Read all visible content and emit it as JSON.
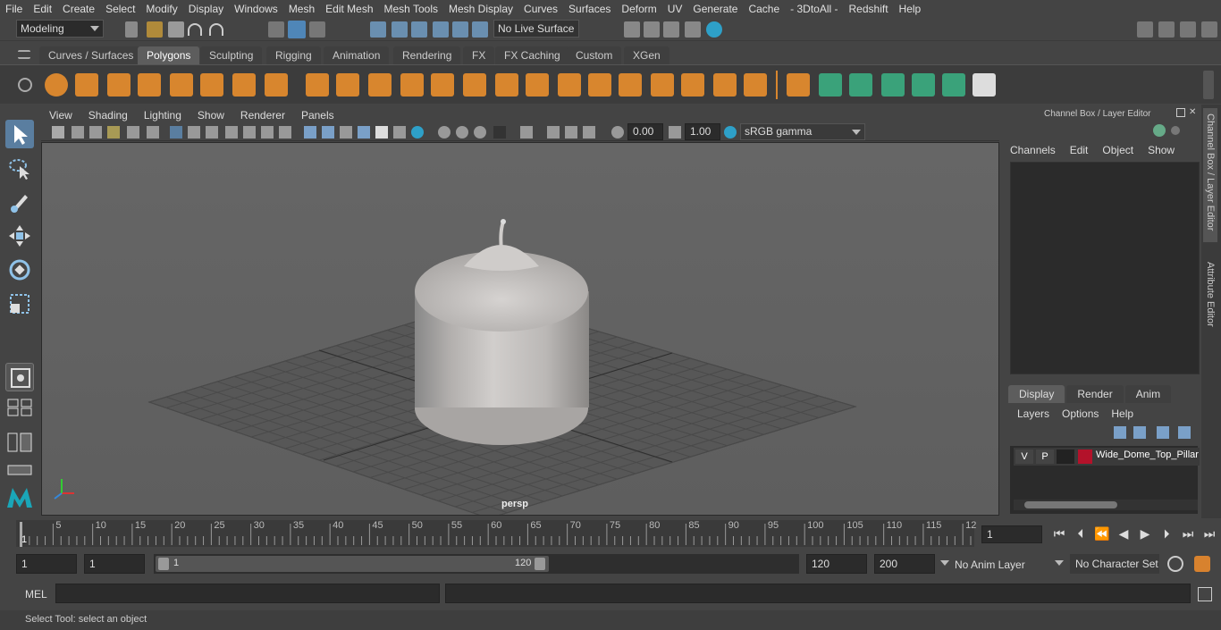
{
  "menu": [
    "File",
    "Edit",
    "Create",
    "Select",
    "Modify",
    "Display",
    "Windows",
    "Mesh",
    "Edit Mesh",
    "Mesh Tools",
    "Mesh Display",
    "Curves",
    "Surfaces",
    "Deform",
    "UV",
    "Generate",
    "Cache",
    "- 3DtoAll -",
    "Redshift",
    "Help"
  ],
  "status": {
    "mode": "Modeling",
    "live_surface": "No Live Surface"
  },
  "shelf_tabs": [
    "Curves / Surfaces",
    "Polygons",
    "Sculpting",
    "Rigging",
    "Animation",
    "Rendering",
    "FX",
    "FX Caching",
    "Custom",
    "XGen"
  ],
  "shelf_active": "Polygons",
  "viewport": {
    "menus": [
      "View",
      "Shading",
      "Lighting",
      "Show",
      "Renderer",
      "Panels"
    ],
    "exposure": "0.00",
    "gamma": "1.00",
    "color_space": "sRGB gamma",
    "camera_label": "persp"
  },
  "channel_box": {
    "title": "Channel Box / Layer Editor",
    "menus": [
      "Channels",
      "Edit",
      "Object",
      "Show"
    ],
    "layer_tabs": [
      "Display",
      "Render",
      "Anim"
    ],
    "layer_tab_active": "Display",
    "layer_menus": [
      "Layers",
      "Options",
      "Help"
    ],
    "layer": {
      "v": "V",
      "p": "P",
      "name": "Wide_Dome_Top_Pillar",
      "color": "#b3122a"
    }
  },
  "side_tabs": [
    "Channel Box / Layer Editor",
    "Attribute Editor"
  ],
  "timeline": {
    "ticks": [
      "5",
      "10",
      "15",
      "20",
      "25",
      "30",
      "35",
      "40",
      "45",
      "50",
      "55",
      "60",
      "65",
      "70",
      "75",
      "80",
      "85",
      "90",
      "95",
      "100",
      "105",
      "110",
      "115",
      "12"
    ],
    "start_label": "1",
    "current_frame": "1"
  },
  "range": {
    "start": "1",
    "playback_start": "1",
    "slider_start": "1",
    "slider_end": "120",
    "playback_end": "120",
    "end": "200",
    "anim_layer": "No Anim Layer",
    "character_set": "No Character Set"
  },
  "command": {
    "label": "MEL"
  },
  "help_text": "Select Tool: select an object"
}
